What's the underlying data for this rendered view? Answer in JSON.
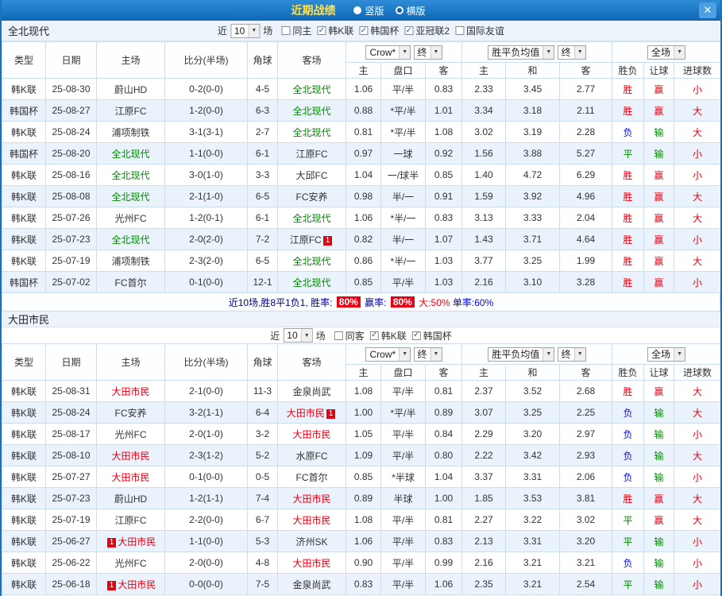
{
  "titlebar": {
    "title": "近期战绩",
    "layout_options": [
      {
        "label": "竖版",
        "selected": false
      },
      {
        "label": "横版",
        "selected": true
      }
    ],
    "close_label": "✕"
  },
  "result_colors": {
    "胜": "#e60012",
    "平": "#008a00",
    "负": "#0b0be0",
    "赢": "#e60012",
    "输": "#008a00",
    "大": "#e60012",
    "小": "#e60012"
  },
  "team_colors": [
    "#008800",
    "#e60012"
  ],
  "table_headers": {
    "main": [
      "类型",
      "日期",
      "主场",
      "比分(半场)",
      "角球",
      "客场"
    ],
    "asian_sub": [
      "主",
      "盘口",
      "客"
    ],
    "europe_sub": [
      "主",
      "和",
      "客"
    ],
    "result_sub": [
      "胜负",
      "让球",
      "进球数"
    ],
    "dropdowns": {
      "bookmaker": "Crow*",
      "final1": "终",
      "average": "胜平负均值",
      "final2": "终",
      "scope": "全场"
    }
  },
  "sections": [
    {
      "team": "全北现代",
      "filter": {
        "prefix": "近",
        "count": "10",
        "suffix": "场",
        "checkboxes": [
          {
            "label": "同主",
            "mark": ""
          },
          {
            "label": "韩K联",
            "mark": "✓"
          },
          {
            "label": "韩国杯",
            "mark": "✓"
          },
          {
            "label": "亚冠联2",
            "mark": "✓"
          },
          {
            "label": "国际友谊",
            "mark": ""
          }
        ]
      },
      "rows": [
        {
          "league": "韩K联",
          "date": "25-08-30",
          "home": "蔚山HD",
          "home_badge": "",
          "score": "0-2(0-0)",
          "corners": "4-5",
          "away": "全北现代",
          "away_badge": "",
          "ah_home": "1.06",
          "ah_line": "平/半",
          "ah_away": "0.83",
          "eu_home": "2.33",
          "eu_draw": "3.45",
          "eu_away": "2.77",
          "res_wdl": "胜",
          "res_asian": "赢",
          "res_goals": "小"
        },
        {
          "league": "韩国杯",
          "date": "25-08-27",
          "home": "江原FC",
          "home_badge": "",
          "score": "1-2(0-0)",
          "corners": "6-3",
          "away": "全北现代",
          "away_badge": "",
          "ah_home": "0.88",
          "ah_line": "*平/半",
          "ah_away": "1.01",
          "eu_home": "3.34",
          "eu_draw": "3.18",
          "eu_away": "2.11",
          "res_wdl": "胜",
          "res_asian": "赢",
          "res_goals": "大"
        },
        {
          "league": "韩K联",
          "date": "25-08-24",
          "home": "浦项制铁",
          "home_badge": "",
          "score": "3-1(3-1)",
          "corners": "2-7",
          "away": "全北现代",
          "away_badge": "",
          "ah_home": "0.81",
          "ah_line": "*平/半",
          "ah_away": "1.08",
          "eu_home": "3.02",
          "eu_draw": "3.19",
          "eu_away": "2.28",
          "res_wdl": "负",
          "res_asian": "输",
          "res_goals": "大"
        },
        {
          "league": "韩国杯",
          "date": "25-08-20",
          "home": "全北现代",
          "home_badge": "",
          "score": "1-1(0-0)",
          "corners": "6-1",
          "away": "江原FC",
          "away_badge": "",
          "ah_home": "0.97",
          "ah_line": "一球",
          "ah_away": "0.92",
          "eu_home": "1.56",
          "eu_draw": "3.88",
          "eu_away": "5.27",
          "res_wdl": "平",
          "res_asian": "输",
          "res_goals": "小"
        },
        {
          "league": "韩K联",
          "date": "25-08-16",
          "home": "全北现代",
          "home_badge": "",
          "score": "3-0(1-0)",
          "corners": "3-3",
          "away": "大邱FC",
          "away_badge": "",
          "ah_home": "1.04",
          "ah_line": "一/球半",
          "ah_away": "0.85",
          "eu_home": "1.40",
          "eu_draw": "4.72",
          "eu_away": "6.29",
          "res_wdl": "胜",
          "res_asian": "赢",
          "res_goals": "小"
        },
        {
          "league": "韩K联",
          "date": "25-08-08",
          "home": "全北现代",
          "home_badge": "",
          "score": "2-1(1-0)",
          "corners": "6-5",
          "away": "FC安养",
          "away_badge": "",
          "ah_home": "0.98",
          "ah_line": "半/一",
          "ah_away": "0.91",
          "eu_home": "1.59",
          "eu_draw": "3.92",
          "eu_away": "4.96",
          "res_wdl": "胜",
          "res_asian": "赢",
          "res_goals": "大"
        },
        {
          "league": "韩K联",
          "date": "25-07-26",
          "home": "光州FC",
          "home_badge": "",
          "score": "1-2(0-1)",
          "corners": "6-1",
          "away": "全北现代",
          "away_badge": "",
          "ah_home": "1.06",
          "ah_line": "*半/一",
          "ah_away": "0.83",
          "eu_home": "3.13",
          "eu_draw": "3.33",
          "eu_away": "2.04",
          "res_wdl": "胜",
          "res_asian": "赢",
          "res_goals": "大"
        },
        {
          "league": "韩K联",
          "date": "25-07-23",
          "home": "全北现代",
          "home_badge": "",
          "score": "2-0(2-0)",
          "corners": "7-2",
          "away": "江原FC",
          "away_badge": "1",
          "ah_home": "0.82",
          "ah_line": "半/一",
          "ah_away": "1.07",
          "eu_home": "1.43",
          "eu_draw": "3.71",
          "eu_away": "4.64",
          "res_wdl": "胜",
          "res_asian": "赢",
          "res_goals": "小"
        },
        {
          "league": "韩K联",
          "date": "25-07-19",
          "home": "浦项制铁",
          "home_badge": "",
          "score": "2-3(2-0)",
          "corners": "6-5",
          "away": "全北现代",
          "away_badge": "",
          "ah_home": "0.86",
          "ah_line": "*半/一",
          "ah_away": "1.03",
          "eu_home": "3.77",
          "eu_draw": "3.25",
          "eu_away": "1.99",
          "res_wdl": "胜",
          "res_asian": "赢",
          "res_goals": "大"
        },
        {
          "league": "韩国杯",
          "date": "25-07-02",
          "home": "FC首尔",
          "home_badge": "",
          "score": "0-1(0-0)",
          "corners": "12-1",
          "away": "全北现代",
          "away_badge": "",
          "ah_home": "0.85",
          "ah_line": "平/半",
          "ah_away": "1.03",
          "eu_home": "2.16",
          "eu_draw": "3.10",
          "eu_away": "3.28",
          "res_wdl": "胜",
          "res_asian": "赢",
          "res_goals": "小"
        }
      ],
      "summary": [
        {
          "text": "近10场,胜8平1负1, 胜率: ",
          "style": "navy"
        },
        {
          "text": "80%",
          "style": "badge"
        },
        {
          "text": " 赢率: ",
          "style": "navy"
        },
        {
          "text": "80%",
          "style": "badge"
        },
        {
          "text": " 大:50% ",
          "style": "red"
        },
        {
          "text": "单率:60%",
          "style": "blue"
        }
      ]
    },
    {
      "team": "大田市民",
      "filter": {
        "prefix": "近",
        "count": "10",
        "suffix": "场",
        "checkboxes": [
          {
            "label": "同客",
            "mark": ""
          },
          {
            "label": "韩K联",
            "mark": "✓"
          },
          {
            "label": "韩国杯",
            "mark": "✓"
          }
        ]
      },
      "rows": [
        {
          "league": "韩K联",
          "date": "25-08-31",
          "home": "大田市民",
          "home_badge": "",
          "score": "2-1(0-0)",
          "corners": "11-3",
          "away": "金泉尚武",
          "away_badge": "",
          "ah_home": "1.08",
          "ah_line": "平/半",
          "ah_away": "0.81",
          "eu_home": "2.37",
          "eu_draw": "3.52",
          "eu_away": "2.68",
          "res_wdl": "胜",
          "res_asian": "赢",
          "res_goals": "大"
        },
        {
          "league": "韩K联",
          "date": "25-08-24",
          "home": "FC安养",
          "home_badge": "",
          "score": "3-2(1-1)",
          "corners": "6-4",
          "away": "大田市民",
          "away_badge": "1",
          "ah_home": "1.00",
          "ah_line": "*平/半",
          "ah_away": "0.89",
          "eu_home": "3.07",
          "eu_draw": "3.25",
          "eu_away": "2.25",
          "res_wdl": "负",
          "res_asian": "输",
          "res_goals": "大"
        },
        {
          "league": "韩K联",
          "date": "25-08-17",
          "home": "光州FC",
          "home_badge": "",
          "score": "2-0(1-0)",
          "corners": "3-2",
          "away": "大田市民",
          "away_badge": "",
          "ah_home": "1.05",
          "ah_line": "平/半",
          "ah_away": "0.84",
          "eu_home": "2.29",
          "eu_draw": "3.20",
          "eu_away": "2.97",
          "res_wdl": "负",
          "res_asian": "输",
          "res_goals": "小"
        },
        {
          "league": "韩K联",
          "date": "25-08-10",
          "home": "大田市民",
          "home_badge": "",
          "score": "2-3(1-2)",
          "corners": "5-2",
          "away": "水原FC",
          "away_badge": "",
          "ah_home": "1.09",
          "ah_line": "平/半",
          "ah_away": "0.80",
          "eu_home": "2.22",
          "eu_draw": "3.42",
          "eu_away": "2.93",
          "res_wdl": "负",
          "res_asian": "输",
          "res_goals": "大"
        },
        {
          "league": "韩K联",
          "date": "25-07-27",
          "home": "大田市民",
          "home_badge": "",
          "score": "0-1(0-0)",
          "corners": "0-5",
          "away": "FC首尔",
          "away_badge": "",
          "ah_home": "0.85",
          "ah_line": "*半球",
          "ah_away": "1.04",
          "eu_home": "3.37",
          "eu_draw": "3.31",
          "eu_away": "2.06",
          "res_wdl": "负",
          "res_asian": "输",
          "res_goals": "小"
        },
        {
          "league": "韩K联",
          "date": "25-07-23",
          "home": "蔚山HD",
          "home_badge": "",
          "score": "1-2(1-1)",
          "corners": "7-4",
          "away": "大田市民",
          "away_badge": "",
          "ah_home": "0.89",
          "ah_line": "半球",
          "ah_away": "1.00",
          "eu_home": "1.85",
          "eu_draw": "3.53",
          "eu_away": "3.81",
          "res_wdl": "胜",
          "res_asian": "赢",
          "res_goals": "大"
        },
        {
          "league": "韩K联",
          "date": "25-07-19",
          "home": "江原FC",
          "home_badge": "",
          "score": "2-2(0-0)",
          "corners": "6-7",
          "away": "大田市民",
          "away_badge": "",
          "ah_home": "1.08",
          "ah_line": "平/半",
          "ah_away": "0.81",
          "eu_home": "2.27",
          "eu_draw": "3.22",
          "eu_away": "3.02",
          "res_wdl": "平",
          "res_asian": "赢",
          "res_goals": "大"
        },
        {
          "league": "韩K联",
          "date": "25-06-27",
          "home": "大田市民",
          "home_badge": "1",
          "score": "1-1(0-0)",
          "corners": "5-3",
          "away": "济州SK",
          "away_badge": "",
          "ah_home": "1.06",
          "ah_line": "平/半",
          "ah_away": "0.83",
          "eu_home": "2.13",
          "eu_draw": "3.31",
          "eu_away": "3.20",
          "res_wdl": "平",
          "res_asian": "输",
          "res_goals": "小"
        },
        {
          "league": "韩K联",
          "date": "25-06-22",
          "home": "光州FC",
          "home_badge": "",
          "score": "2-0(0-0)",
          "corners": "4-8",
          "away": "大田市民",
          "away_badge": "",
          "ah_home": "0.90",
          "ah_line": "平/半",
          "ah_away": "0.99",
          "eu_home": "2.16",
          "eu_draw": "3.21",
          "eu_away": "3.21",
          "res_wdl": "负",
          "res_asian": "输",
          "res_goals": "小"
        },
        {
          "league": "韩K联",
          "date": "25-06-18",
          "home": "大田市民",
          "home_badge": "1",
          "score": "0-0(0-0)",
          "corners": "7-5",
          "away": "金泉尚武",
          "away_badge": "",
          "ah_home": "0.83",
          "ah_line": "平/半",
          "ah_away": "1.06",
          "eu_home": "2.35",
          "eu_draw": "3.21",
          "eu_away": "2.54",
          "res_wdl": "平",
          "res_asian": "输",
          "res_goals": "小"
        }
      ]
    }
  ]
}
